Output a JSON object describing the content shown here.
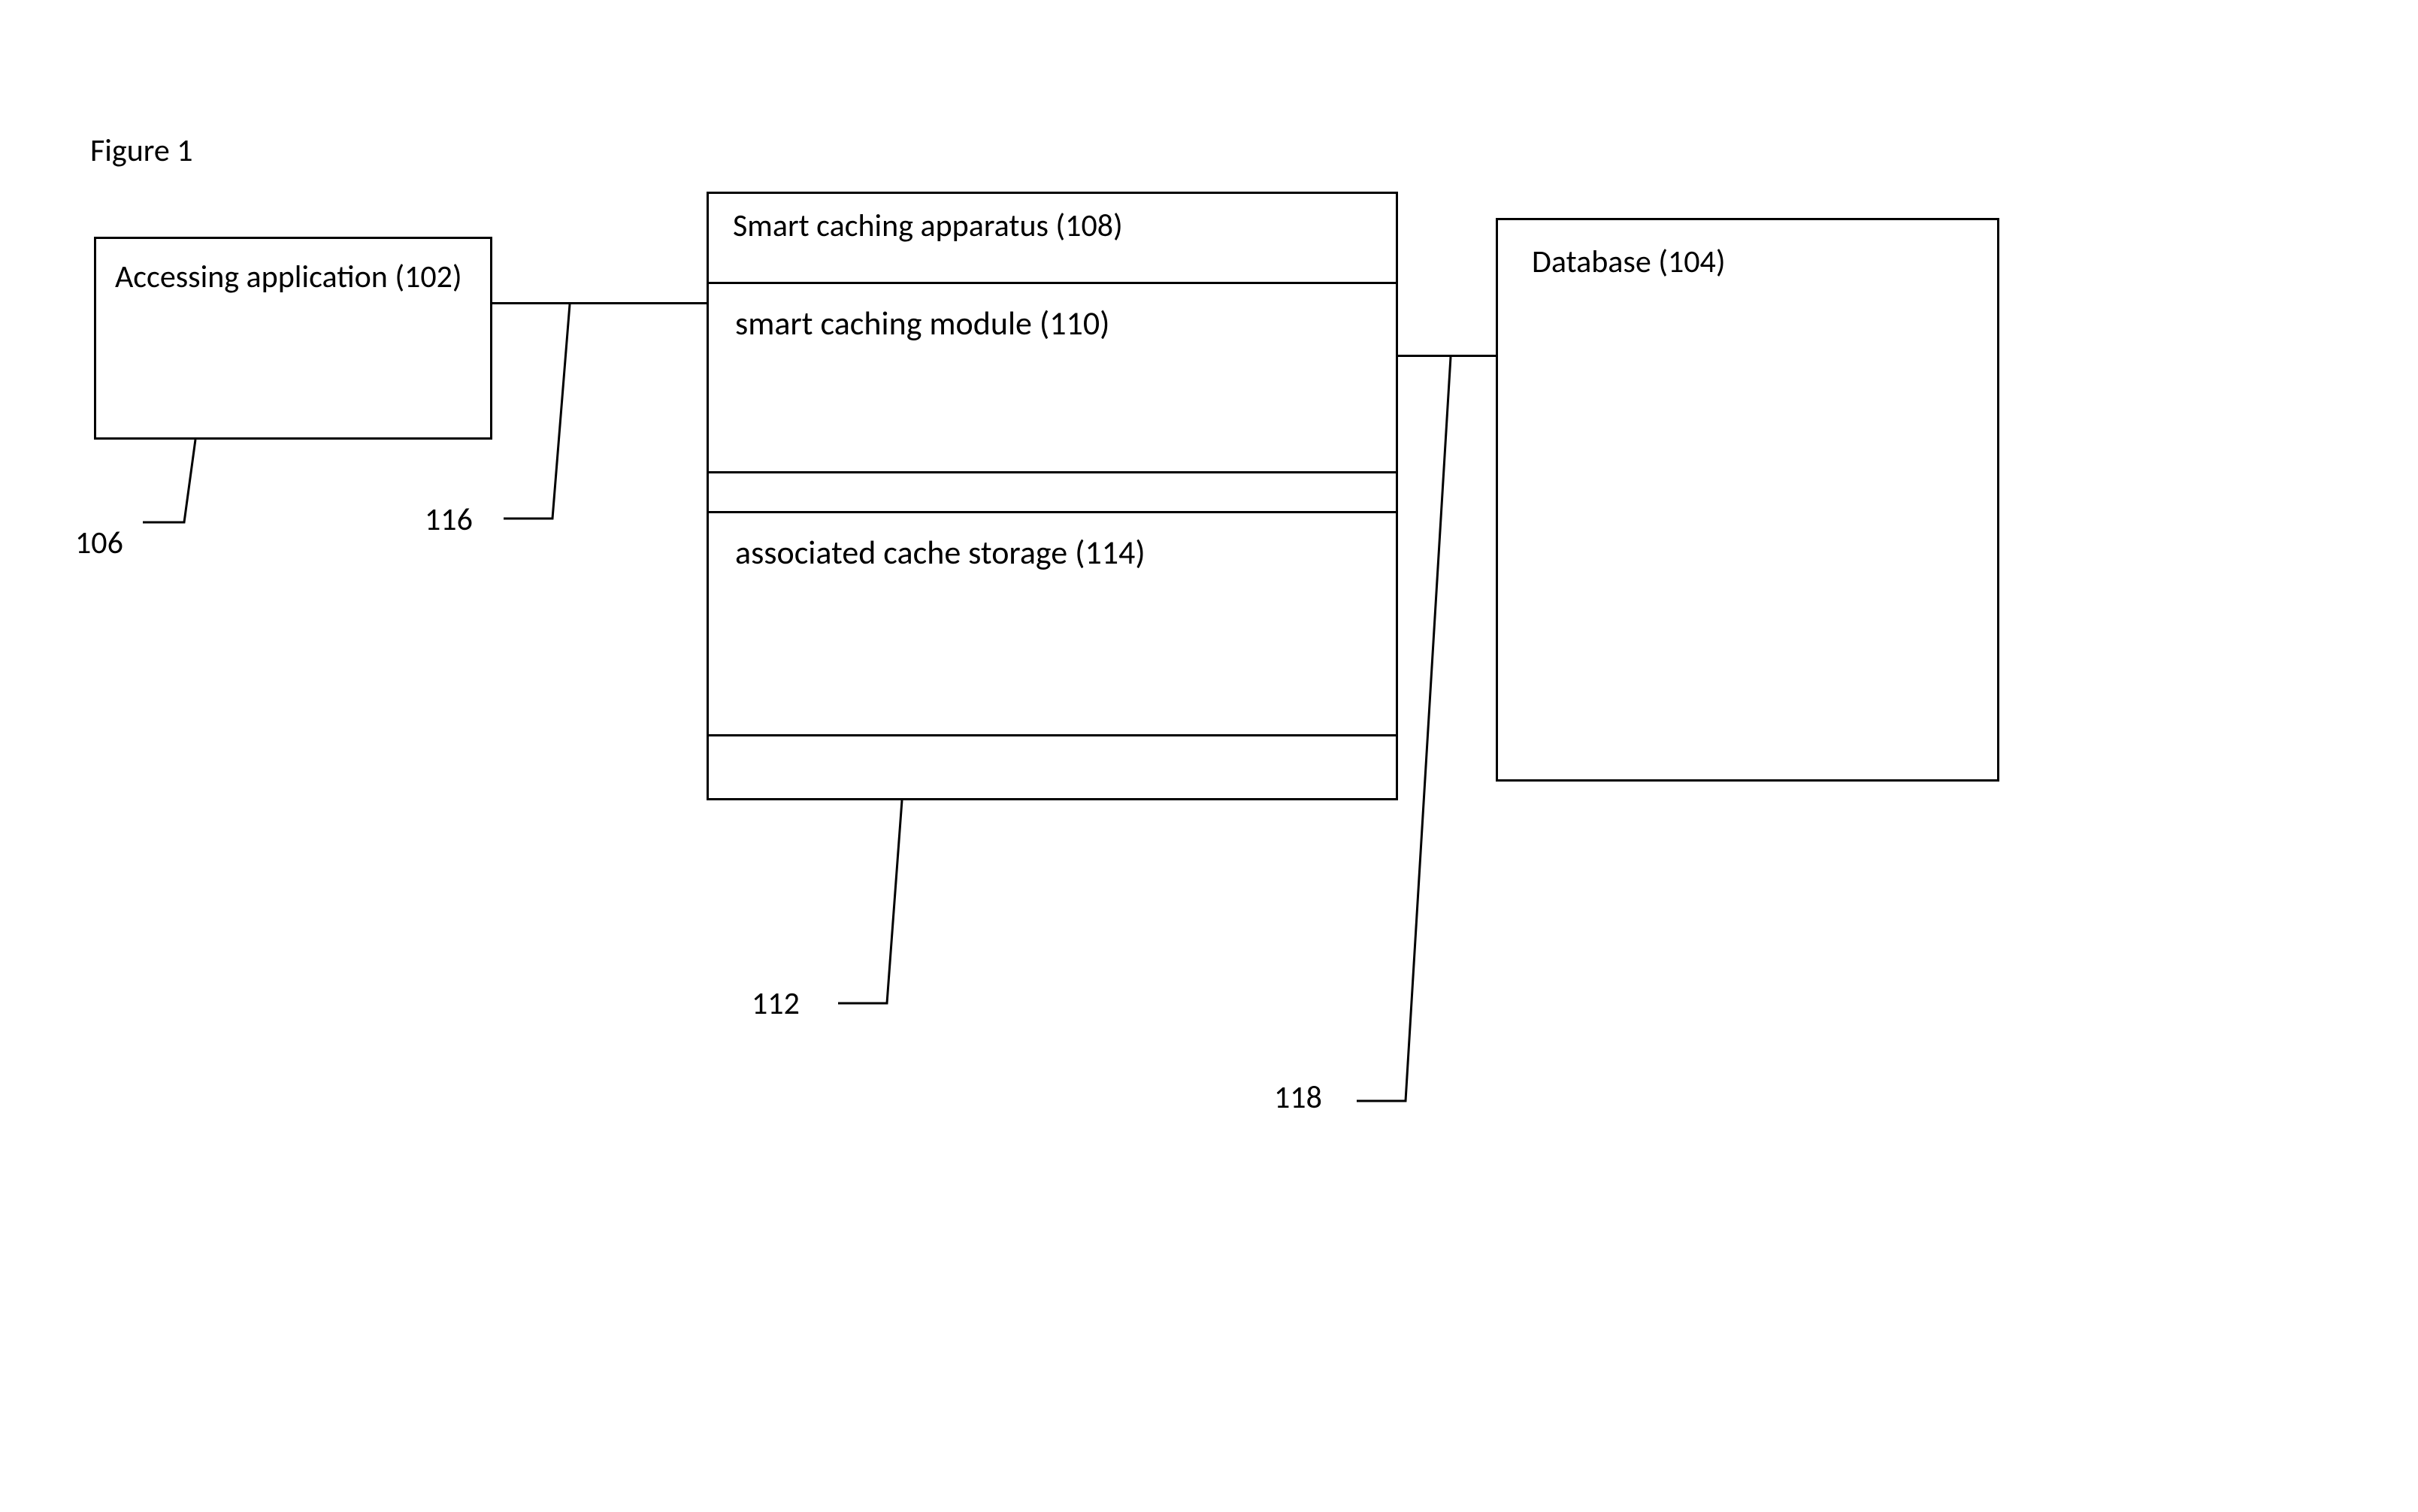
{
  "figure_title": "Figure 1",
  "blocks": {
    "accessing_application": {
      "label": "Accessing application (102)",
      "ref": "102"
    },
    "smart_caching_apparatus": {
      "label": "Smart caching apparatus (108)",
      "ref": "108"
    },
    "smart_caching_module": {
      "label": "smart caching module (110)",
      "ref": "110"
    },
    "associated_cache_storage": {
      "label": "associated cache storage (114)",
      "ref": "114"
    },
    "database": {
      "label": "Database (104)",
      "ref": "104"
    }
  },
  "reference_numerals": {
    "r106": "106",
    "r116": "116",
    "r112": "112",
    "r118": "118"
  }
}
